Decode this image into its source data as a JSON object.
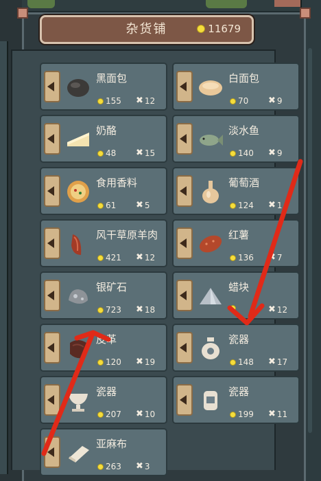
{
  "shop": {
    "title": "杂货铺",
    "coins": "11679"
  },
  "items": [
    {
      "name": "黑面包",
      "price": "155",
      "qty": "12",
      "icon": "dark-bread-icon"
    },
    {
      "name": "白面包",
      "price": "70",
      "qty": "9",
      "icon": "white-bread-icon"
    },
    {
      "name": "奶酪",
      "price": "48",
      "qty": "15",
      "icon": "cheese-icon"
    },
    {
      "name": "淡水鱼",
      "price": "140",
      "qty": "9",
      "icon": "fish-icon"
    },
    {
      "name": "食用香料",
      "price": "61",
      "qty": "5",
      "icon": "spice-bowl-icon"
    },
    {
      "name": "葡萄酒",
      "price": "124",
      "qty": "1",
      "icon": "wine-flask-icon"
    },
    {
      "name": "风干草原羊肉",
      "price": "421",
      "qty": "12",
      "icon": "dried-mutton-icon"
    },
    {
      "name": "红薯",
      "price": "136",
      "qty": "7",
      "icon": "sweet-potato-icon"
    },
    {
      "name": "银矿石",
      "price": "723",
      "qty": "18",
      "icon": "silver-ore-icon"
    },
    {
      "name": "蜡块",
      "price": "",
      "qty": "12",
      "icon": "wax-block-icon"
    },
    {
      "name": "皮革",
      "price": "120",
      "qty": "19",
      "icon": "leather-icon"
    },
    {
      "name": "瓷器",
      "price": "148",
      "qty": "17",
      "icon": "porcelain-vase-icon"
    },
    {
      "name": "瓷器",
      "price": "207",
      "qty": "10",
      "icon": "porcelain-cup-icon"
    },
    {
      "name": "瓷器",
      "price": "199",
      "qty": "11",
      "icon": "porcelain-jar-icon"
    },
    {
      "name": "亚麻布",
      "price": "263",
      "qty": "3",
      "icon": "linen-cloth-icon"
    }
  ],
  "colors": {
    "accent_coin": "#f5dd3c",
    "annotation_arrow": "#e02a18",
    "card_bg": "#5b6f76"
  }
}
